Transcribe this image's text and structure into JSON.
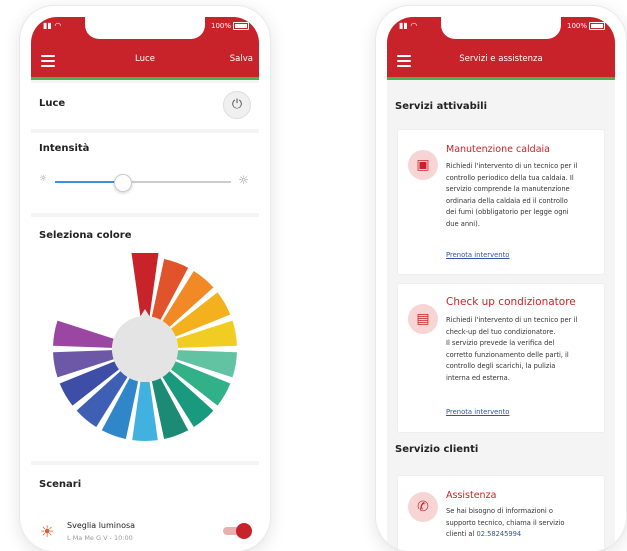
{
  "luce": {
    "status": {
      "battery": "100%"
    },
    "header": {
      "title": "Luce",
      "save_label": "Salva"
    },
    "power_section": {
      "label": "Luce"
    },
    "intensity_section": {
      "label": "Intensità",
      "level": 0.38
    },
    "color_section": {
      "label": "Seleziona colore"
    },
    "wheel_colors": [
      "#c8232a",
      "#e0532b",
      "#f18a24",
      "#f3b21d",
      "#f1cc22",
      "#62c3a2",
      "#32b088",
      "#199a7e",
      "#1c8a74",
      "#41b1df",
      "#2f86c9",
      "#3e5fb4",
      "#3e4da6",
      "#6d58a8",
      "#9b46a3",
      "#ffffff",
      "#ffffff",
      "#ffffff"
    ],
    "scenari": {
      "label": "Scenari",
      "items": [
        {
          "name": "Sveglia luminosa",
          "schedule": "L Ma Me G V - 10:00",
          "enabled": true
        }
      ]
    }
  },
  "servizi": {
    "status": {
      "battery": "100%"
    },
    "header": {
      "title": "Servizi e assistenza"
    },
    "attivabili_label": "Servizi attivabili",
    "cards": [
      {
        "title": "Manutenzione caldaia",
        "icon": "boiler-icon",
        "lines": [
          "Richiedi l'intervento di un tecnico per il",
          "controllo periodico della tua caldaia. Il",
          "servizio comprende la manutenzione",
          "ordinaria della caldaia ed il controllo",
          "dei fumi (obbligatorio per legge ogni",
          "due anni)."
        ],
        "link": "Prenota intervento"
      },
      {
        "title": "Check up condizionatore",
        "icon": "air-conditioner-icon",
        "lines": [
          "Richiedi l'intervento di un tecnico per il",
          "check-up del tuo condizionatore.",
          "Il servizio prevede la verifica del",
          "corretto funzionamento delle parti, il",
          "controllo degli scarichi, la pulizia",
          "interna ed esterna."
        ],
        "link": "Prenota intervento"
      }
    ],
    "clienti_label": "Servizio clienti",
    "assistenza": {
      "title": "Assistenza",
      "icon": "phone-icon",
      "lines": [
        "Se hai bisogno di informazioni o",
        "supporto tecnico, chiama il servizio"
      ],
      "last_line_prefix": "clienti al",
      "phone": "02.58245994"
    }
  }
}
